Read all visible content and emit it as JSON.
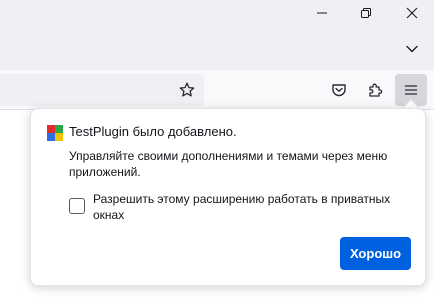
{
  "window_controls": {
    "minimize_icon": "minimize-icon",
    "restore_icon": "restore-icon",
    "close_icon": "close-icon"
  },
  "tabstrip": {
    "list_all_tabs_icon": "chevron-down-icon"
  },
  "toolbar": {
    "bookmark_icon": "star-icon",
    "pocket_icon": "pocket-icon",
    "extensions_icon": "puzzle-icon",
    "menu_icon": "hamburger-menu-icon"
  },
  "addon_panel": {
    "title": "TestPlugin было добавлено.",
    "description": "Управляйте своими дополнениями и темами через меню приложений.",
    "checkbox_label": "Разрешить этому расширению работать в приватных окнах",
    "checkbox_checked": false,
    "confirm_button": "Хорошо",
    "accent_color": "#0061e0"
  }
}
